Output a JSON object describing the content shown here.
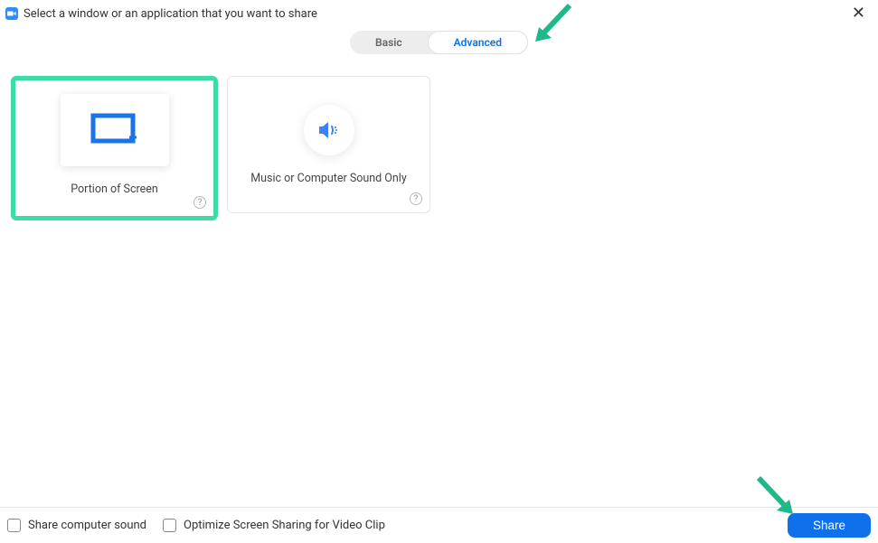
{
  "header": {
    "title": "Select a window or an application that you want to share"
  },
  "tabs": {
    "basic": "Basic",
    "advanced": "Advanced"
  },
  "cards": {
    "portion": {
      "label": "Portion of Screen"
    },
    "music": {
      "label": "Music or Computer Sound Only"
    }
  },
  "footer": {
    "share_sound": "Share computer sound",
    "optimize_video": "Optimize Screen Sharing for Video Clip",
    "share_button": "Share"
  },
  "colors": {
    "accent": "#0e71eb",
    "highlight": "#3ddba8",
    "annotation": "#1fb88a"
  }
}
